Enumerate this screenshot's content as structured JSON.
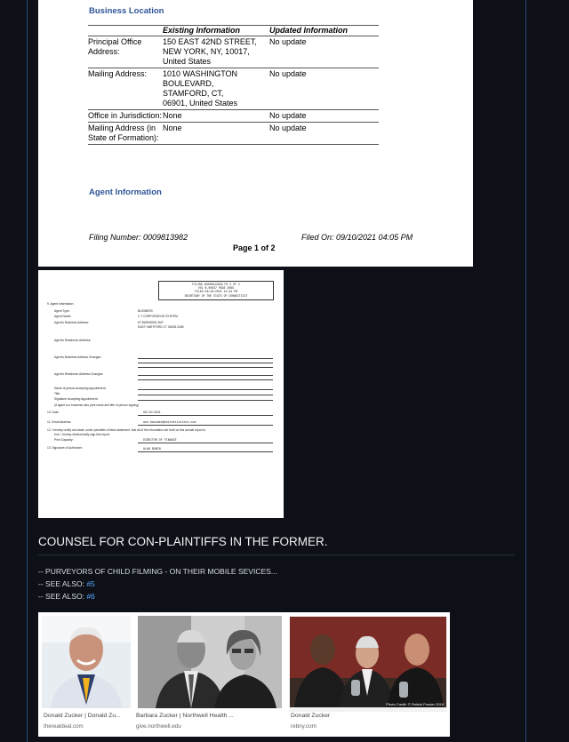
{
  "doc1": {
    "section1": "Business Location",
    "headers": [
      "",
      "Existing Information",
      "Updated Information"
    ],
    "rows": [
      {
        "label": "Principal Office Address:",
        "existing": "150 EAST 42ND STREET, NEW YORK, NY, 10017, United States",
        "updated": "No update"
      },
      {
        "label": "Mailing Address:",
        "existing": "1010 WASHINGTON BOULEVARD, STAMFORD, CT, 06901, United States",
        "updated": "No update"
      },
      {
        "label": "Office in Jurisdiction:",
        "existing": "None",
        "updated": "No update"
      },
      {
        "label": "Mailing Address (in State of Formation):",
        "existing": "None",
        "updated": "No update"
      }
    ],
    "section2": "Agent Information",
    "filing": "Filing Number: 0009813982",
    "filed_on": "Filed On: 09/10/2021 04:05 PM",
    "page": "Page 1 of 2"
  },
  "doc2": {
    "header_lines": [
      "FILING #0009813982 PG 2 OF 2",
      "VOL B-00837 PAGE 3069",
      "FILED 09/10/2021 12:34 PM",
      "SECRETARY OF THE STATE OF CONNECTICUT"
    ],
    "n9": "9.  Agent Information",
    "agent_type_label": "Agent Type:",
    "agent_type": "BUSINESS",
    "agent_name_label": "Agent Name:",
    "agent_name": "C T CORPORATION SYSTEM",
    "agent_bus_label": "Agent's Business Address:",
    "agent_bus_1": "67 BURNSIDE AVE",
    "agent_bus_2": "EAST HARTFORD CT 06108-3408",
    "agent_res_label": "Agent's Residence Address:",
    "bus_changes_label": "Agent's Business Address Changes:",
    "res_changes_label": "Agent's Residence Address Changes:",
    "accepting_name_label": "Name of person accepting appointment:",
    "title_label": "Title:",
    "sig_accept_label": "Signature Accepting Appointment:",
    "if_agent_note": "(If agent is a business also print name and title of person signing)",
    "n10": "10. Date:",
    "date_val": "09/10/2021",
    "n11": "11. Email Address:",
    "email_val": "ann.bannake@whitebriceless.com",
    "n12a": "12. I hereby certify and state, under penalties of false statement, that all of the information set forth on this annual report is",
    "n12b": "true. I hereby electronically sign this report.",
    "print_cap": "Print Capacity:",
    "print_cap_val": "DIRECTOR OF FINANCE",
    "n13": "13. Signature of Authorizer:",
    "sig_val": "ALAN BOBIN"
  },
  "heading": "COUNSEL FOR CON-PLAINTIFFS IN THE FORMER.",
  "line1": "-- PURVEYORS OF CHILD FILMING - ON THEIR MOBILE SEVICES...",
  "see_prefix": "-- SEE ALSO: ",
  "link1": "#5",
  "link2": "#6",
  "cards": [
    {
      "title": "Donald Zucker | Donald Zu...",
      "source": "therealdeal.com"
    },
    {
      "title": "Barbara Zucker | Northwell Health ...",
      "source": "give.northwell.edu"
    },
    {
      "title": "Donald Zucker",
      "source": "rebny.com"
    }
  ],
  "photo_credit": "Photo Credit: © Patrick Procter 2018"
}
